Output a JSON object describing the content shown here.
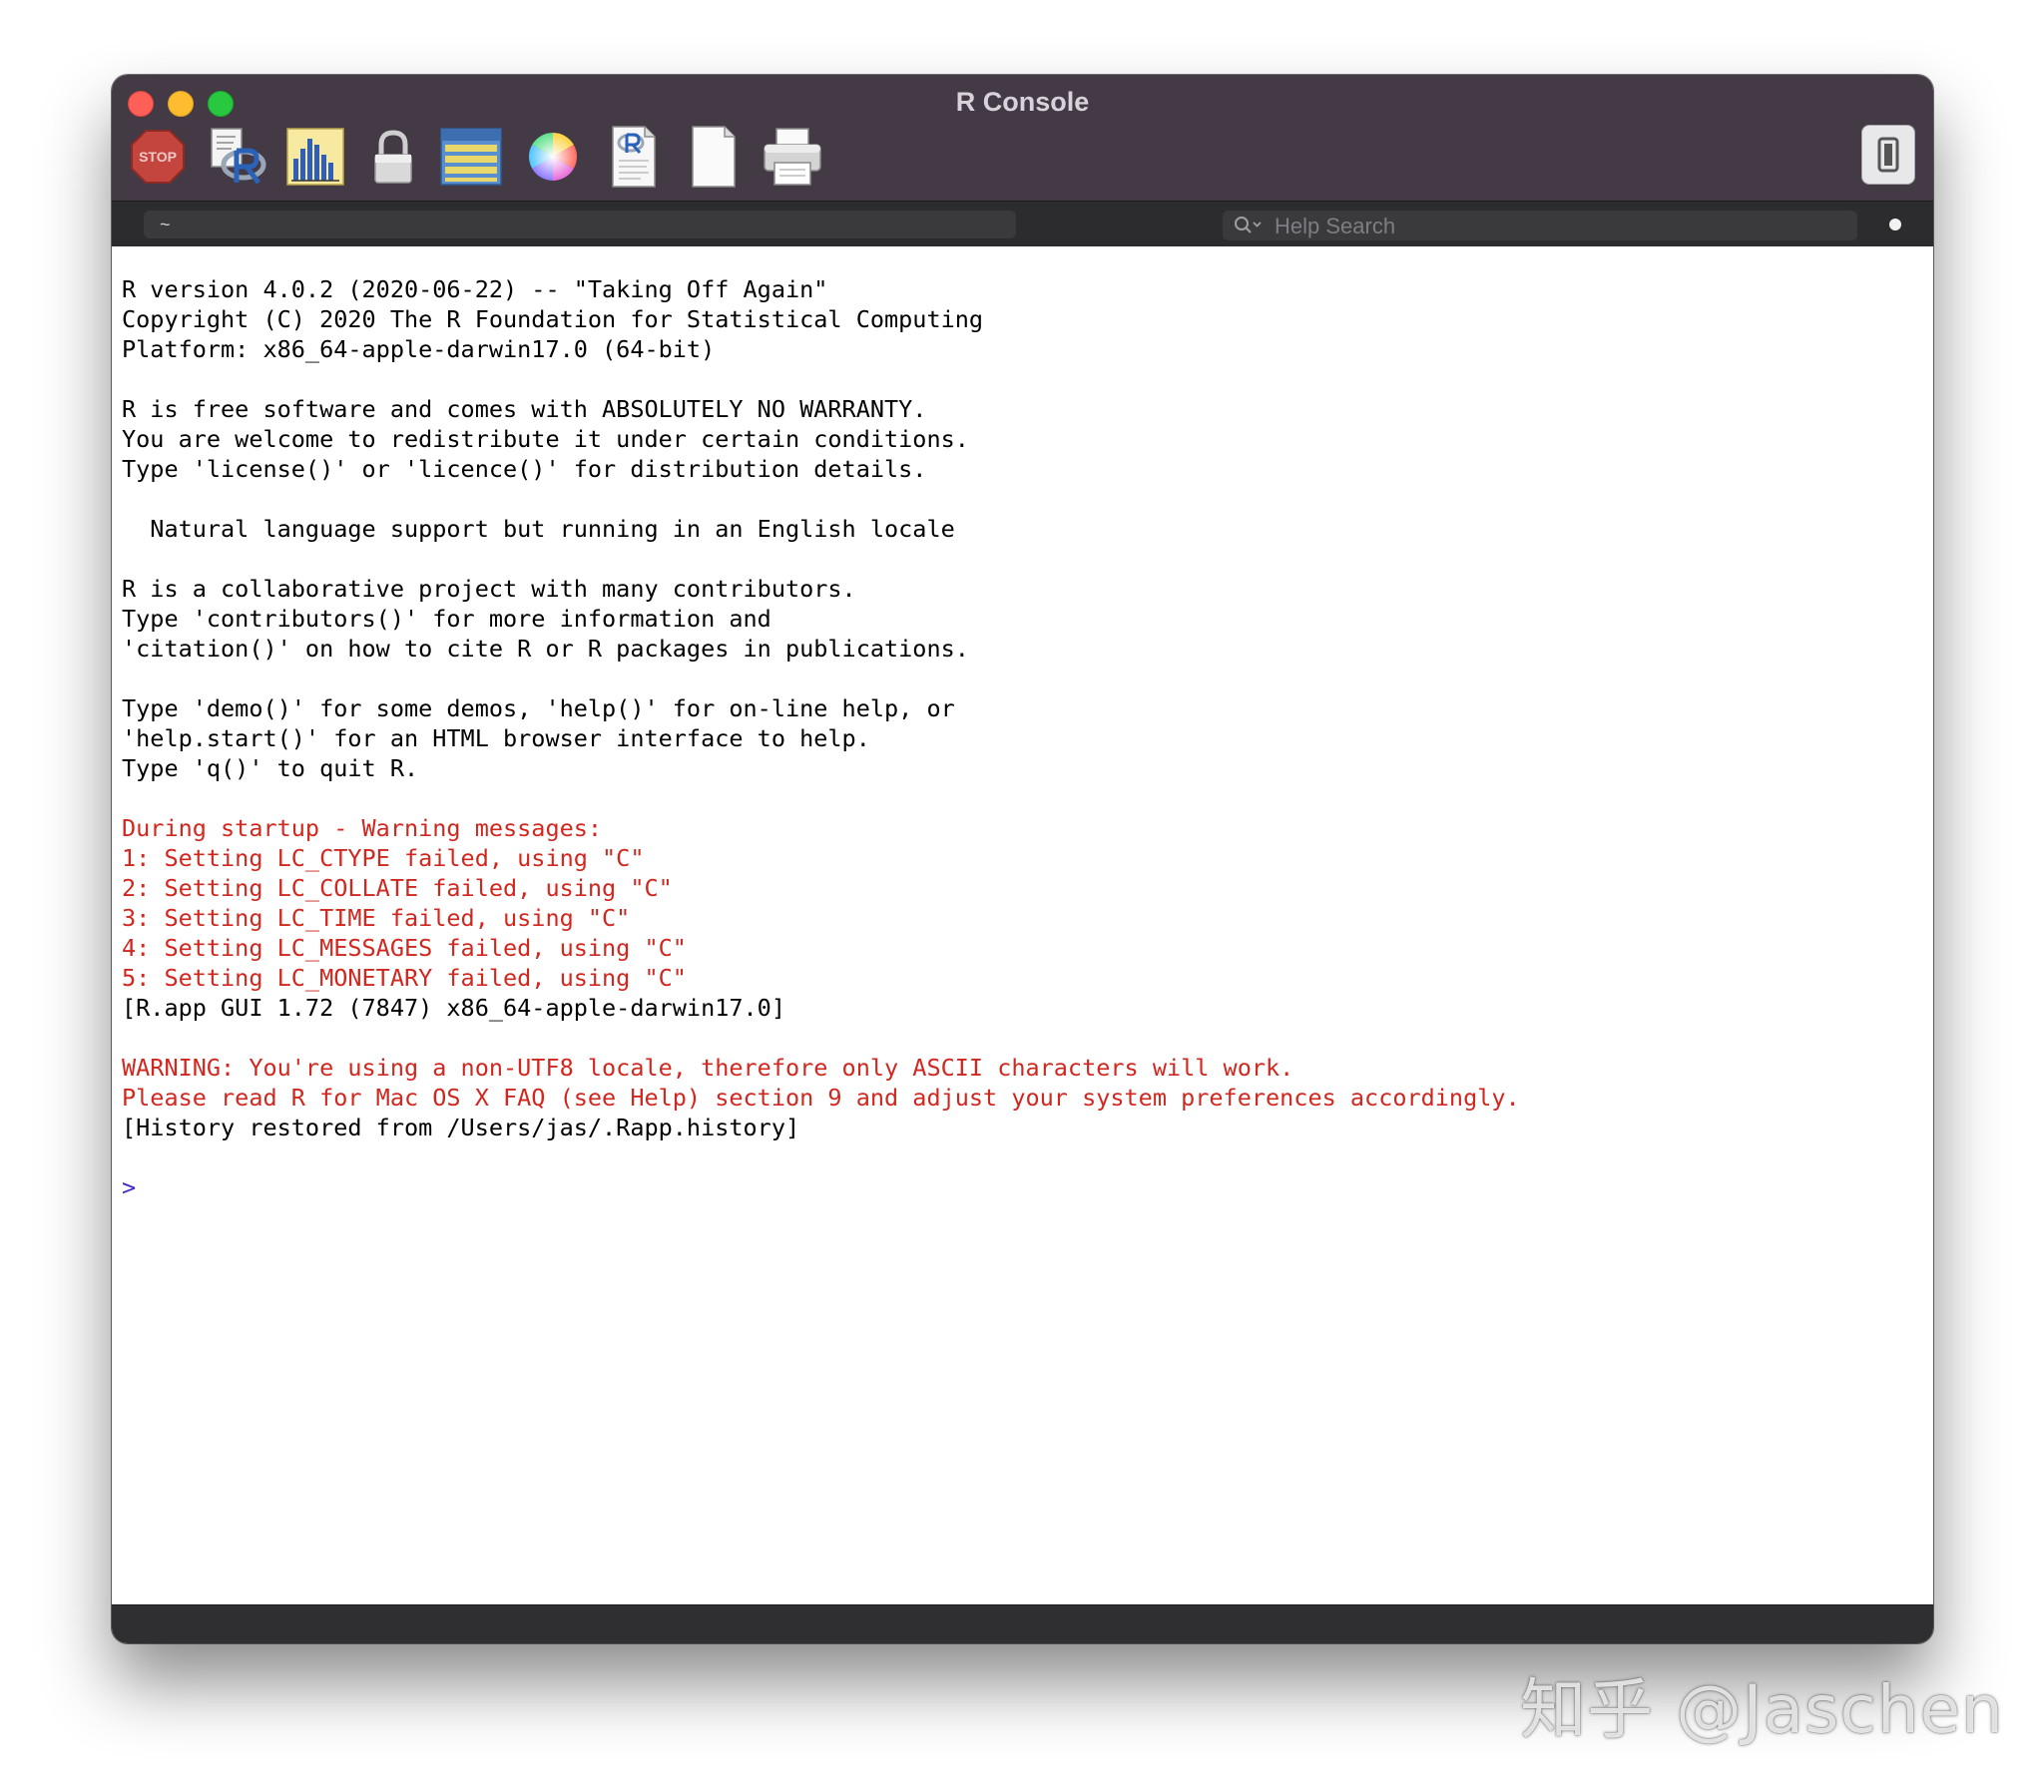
{
  "window": {
    "title": "R Console"
  },
  "toolbar": {
    "buttons": [
      {
        "name": "stop-button",
        "icon": "stop-icon",
        "label": "STOP"
      },
      {
        "name": "source-script-button",
        "icon": "r-script-icon"
      },
      {
        "name": "quartz-plot-button",
        "icon": "bar-chart-icon"
      },
      {
        "name": "authorization-button",
        "icon": "lock-icon"
      },
      {
        "name": "workspace-browser-button",
        "icon": "data-table-icon"
      },
      {
        "name": "set-colors-button",
        "icon": "color-wheel-icon"
      },
      {
        "name": "open-document-button",
        "icon": "r-document-icon"
      },
      {
        "name": "new-document-button",
        "icon": "blank-document-icon"
      },
      {
        "name": "print-button",
        "icon": "printer-icon"
      }
    ],
    "sidebar_toggle_icon": "drawer-toggle-icon"
  },
  "pathbar": {
    "working_directory": "~",
    "search_placeholder": "Help Search"
  },
  "console": {
    "lines": [
      {
        "text": "R version 4.0.2 (2020-06-22) -- \"Taking Off Again\"",
        "kind": "normal"
      },
      {
        "text": "Copyright (C) 2020 The R Foundation for Statistical Computing",
        "kind": "normal"
      },
      {
        "text": "Platform: x86_64-apple-darwin17.0 (64-bit)",
        "kind": "normal"
      },
      {
        "text": "",
        "kind": "normal"
      },
      {
        "text": "R is free software and comes with ABSOLUTELY NO WARRANTY.",
        "kind": "normal"
      },
      {
        "text": "You are welcome to redistribute it under certain conditions.",
        "kind": "normal"
      },
      {
        "text": "Type 'license()' or 'licence()' for distribution details.",
        "kind": "normal"
      },
      {
        "text": "",
        "kind": "normal"
      },
      {
        "text": "  Natural language support but running in an English locale",
        "kind": "normal"
      },
      {
        "text": "",
        "kind": "normal"
      },
      {
        "text": "R is a collaborative project with many contributors.",
        "kind": "normal"
      },
      {
        "text": "Type 'contributors()' for more information and",
        "kind": "normal"
      },
      {
        "text": "'citation()' on how to cite R or R packages in publications.",
        "kind": "normal"
      },
      {
        "text": "",
        "kind": "normal"
      },
      {
        "text": "Type 'demo()' for some demos, 'help()' for on-line help, or",
        "kind": "normal"
      },
      {
        "text": "'help.start()' for an HTML browser interface to help.",
        "kind": "normal"
      },
      {
        "text": "Type 'q()' to quit R.",
        "kind": "normal"
      },
      {
        "text": "",
        "kind": "normal"
      },
      {
        "text": "During startup - Warning messages:",
        "kind": "warn"
      },
      {
        "text": "1: Setting LC_CTYPE failed, using \"C\"",
        "kind": "warn"
      },
      {
        "text": "2: Setting LC_COLLATE failed, using \"C\"",
        "kind": "warn"
      },
      {
        "text": "3: Setting LC_TIME failed, using \"C\"",
        "kind": "warn"
      },
      {
        "text": "4: Setting LC_MESSAGES failed, using \"C\"",
        "kind": "warn"
      },
      {
        "text": "5: Setting LC_MONETARY failed, using \"C\"",
        "kind": "warn"
      },
      {
        "text": "[R.app GUI 1.72 (7847) x86_64-apple-darwin17.0]",
        "kind": "normal"
      },
      {
        "text": "",
        "kind": "normal"
      },
      {
        "text": "WARNING: You're using a non-UTF8 locale, therefore only ASCII characters will work.",
        "kind": "warn"
      },
      {
        "text": "Please read R for Mac OS X FAQ (see Help) section 9 and adjust your system preferences accordingly.",
        "kind": "warn"
      },
      {
        "text": "[History restored from /Users/jas/.Rapp.history]",
        "kind": "normal"
      },
      {
        "text": "",
        "kind": "normal"
      },
      {
        "text": ">",
        "kind": "prompt"
      }
    ]
  },
  "colors": {
    "titlebar": "#433a45",
    "warning_text": "#d1271f",
    "prompt_text": "#3d2ad1"
  },
  "watermark": {
    "text": "知乎 @Jaschen"
  }
}
